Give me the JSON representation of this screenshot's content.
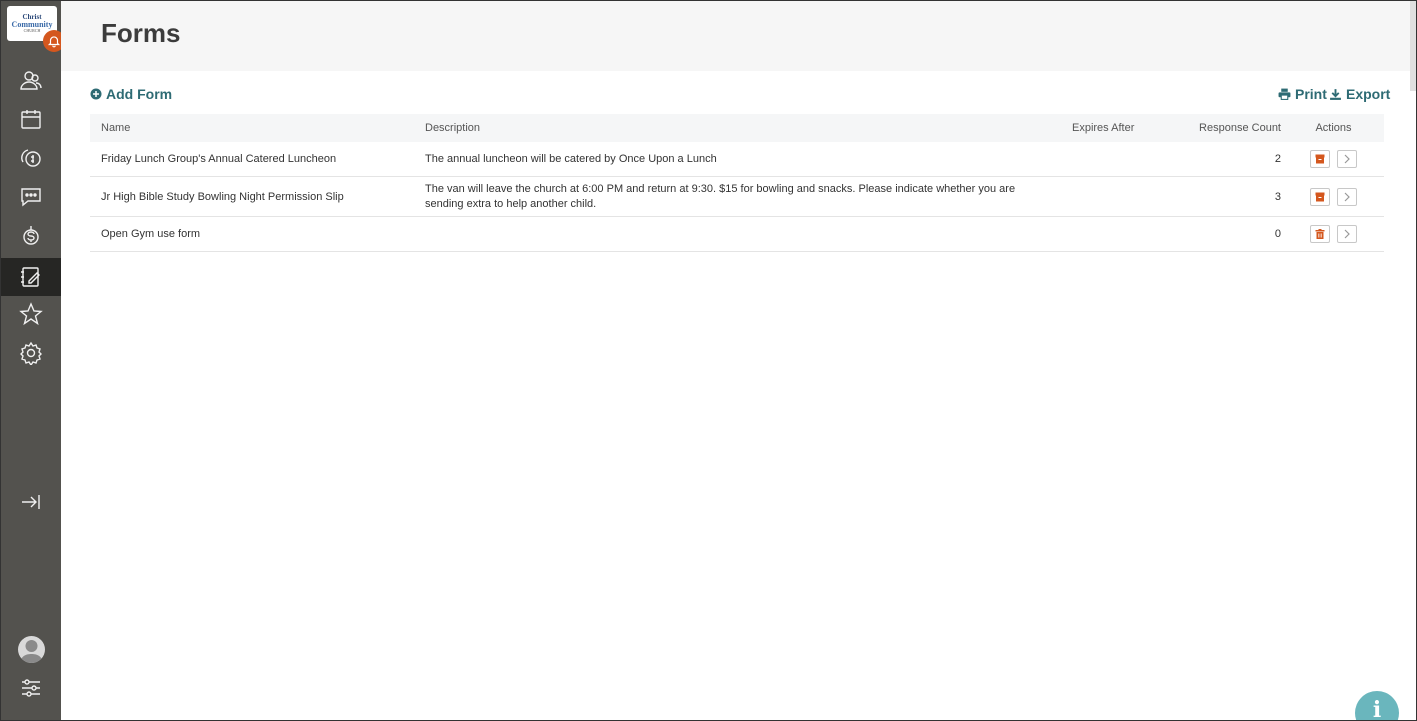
{
  "brand": {
    "logo_line1": "Christ",
    "logo_line2": "Community",
    "logo_line3": "CHURCH",
    "accent_color": "#2e6b74",
    "alert_color": "#d4571e"
  },
  "sidebar": {
    "items": [
      {
        "name": "people",
        "icon": "people-icon"
      },
      {
        "name": "calendar",
        "icon": "calendar-icon"
      },
      {
        "name": "giving",
        "icon": "coins-icon"
      },
      {
        "name": "messages",
        "icon": "chat-icon"
      },
      {
        "name": "finance",
        "icon": "dollar-icon"
      },
      {
        "name": "forms",
        "icon": "notebook-edit-icon",
        "active": true
      },
      {
        "name": "favorites",
        "icon": "star-icon"
      },
      {
        "name": "settings",
        "icon": "gear-icon"
      }
    ]
  },
  "header": {
    "title": "Forms"
  },
  "toolbar": {
    "add_label": "Add Form",
    "print_label": "Print",
    "export_label": "Export"
  },
  "table": {
    "columns": {
      "name": "Name",
      "description": "Description",
      "expires": "Expires After",
      "responses": "Response Count",
      "actions": "Actions"
    },
    "rows": [
      {
        "name": "Friday Lunch Group's Annual Catered Luncheon",
        "description": "The annual luncheon will be catered by Once Upon a Lunch",
        "expires": "",
        "responses": "2",
        "action_icon": "archive-icon"
      },
      {
        "name": "Jr High Bible Study Bowling Night Permission Slip",
        "description": "The van will leave the church at 6:00 PM and return at 9:30. $15 for bowling and snacks. Please indicate whether you are sending extra to help another child.",
        "expires": "",
        "responses": "3",
        "action_icon": "archive-icon"
      },
      {
        "name": "Open Gym use form",
        "description": "",
        "expires": "",
        "responses": "0",
        "action_icon": "trash-icon"
      }
    ]
  },
  "fab": {
    "label": "i"
  }
}
